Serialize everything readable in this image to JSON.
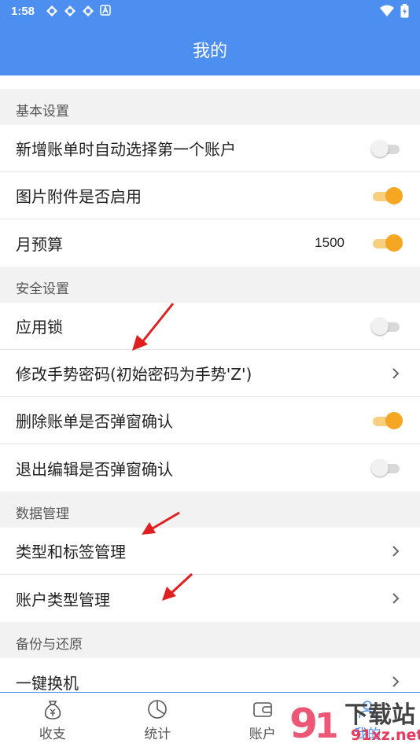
{
  "status_bar": {
    "time": "1:58"
  },
  "header": {
    "title": "我的"
  },
  "sections": [
    {
      "title": "基本设置",
      "rows": [
        {
          "label": "新增账单时自动选择第一个账户",
          "toggle": "off"
        },
        {
          "label": "图片附件是否启用",
          "toggle": "on"
        },
        {
          "label": "月预算",
          "value": "1500",
          "toggle": "on"
        }
      ]
    },
    {
      "title": "安全设置",
      "rows": [
        {
          "label": "应用锁",
          "toggle": "off"
        },
        {
          "label": "修改手势密码(初始密码为手势'Z')",
          "chevron": true
        },
        {
          "label": "删除账单是否弹窗确认",
          "toggle": "on"
        },
        {
          "label": "退出编辑是否弹窗确认",
          "toggle": "off"
        }
      ]
    },
    {
      "title": "数据管理",
      "rows": [
        {
          "label": "类型和标签管理",
          "chevron": true
        },
        {
          "label": "账户类型管理",
          "chevron": true
        }
      ]
    },
    {
      "title": "备份与还原",
      "rows": [
        {
          "label": "一键换机",
          "chevron": true
        }
      ]
    }
  ],
  "bottom_nav": {
    "items": [
      {
        "label": "收支",
        "icon": "money-bag-icon"
      },
      {
        "label": "统计",
        "icon": "pie-chart-icon"
      },
      {
        "label": "账户",
        "icon": "wallet-icon"
      },
      {
        "label": "我的",
        "icon": "person-icon"
      }
    ]
  },
  "watermark": {
    "text": "下载站",
    "sub": "91xz.net"
  },
  "colors": {
    "primary": "#4c8ff1",
    "toggle_on": "#f5a623",
    "arrow": "#e02020"
  }
}
